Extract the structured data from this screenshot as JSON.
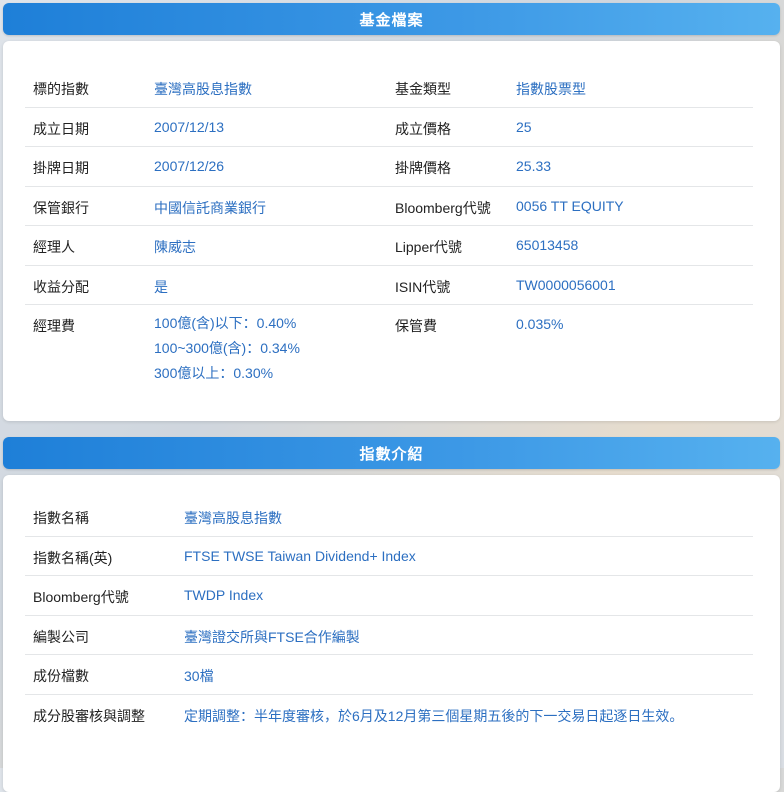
{
  "fund_profile": {
    "title": "基金檔案",
    "rows": [
      {
        "label1": "標的指數",
        "value1": "臺灣高股息指數",
        "label2": "基金類型",
        "value2": "指數股票型"
      },
      {
        "label1": "成立日期",
        "value1": "2007/12/13",
        "label2": "成立價格",
        "value2": "25"
      },
      {
        "label1": "掛牌日期",
        "value1": "2007/12/26",
        "label2": "掛牌價格",
        "value2": "25.33"
      },
      {
        "label1": "保管銀行",
        "value1": "中國信託商業銀行",
        "label2": "Bloomberg代號",
        "value2": "0056 TT EQUITY"
      },
      {
        "label1": "經理人",
        "value1": "陳威志",
        "label2": "Lipper代號",
        "value2": "65013458"
      },
      {
        "label1": "收益分配",
        "value1": "是",
        "label2": "ISIN代號",
        "value2": "TW0000056001"
      }
    ],
    "fee_row": {
      "label1": "經理費",
      "value1_lines": [
        "100億(含)以下：0.40%",
        "100~300億(含)：0.34%",
        "300億以上：0.30%"
      ],
      "label2": "保管費",
      "value2": "0.035%"
    }
  },
  "index_intro": {
    "title": "指數介紹",
    "rows": [
      {
        "label": "指數名稱",
        "value": "臺灣高股息指數"
      },
      {
        "label": "指數名稱(英)",
        "value": "FTSE TWSE Taiwan Dividend+ Index"
      },
      {
        "label": "Bloomberg代號",
        "value": "TWDP Index"
      },
      {
        "label": "編製公司",
        "value": "臺灣證交所與FTSE合作編製"
      },
      {
        "label": "成份檔數",
        "value": "30檔"
      },
      {
        "label": "成分股審核與調整",
        "value": "定期調整：半年度審核，於6月及12月第三個星期五後的下一交易日起逐日生效。"
      }
    ]
  }
}
